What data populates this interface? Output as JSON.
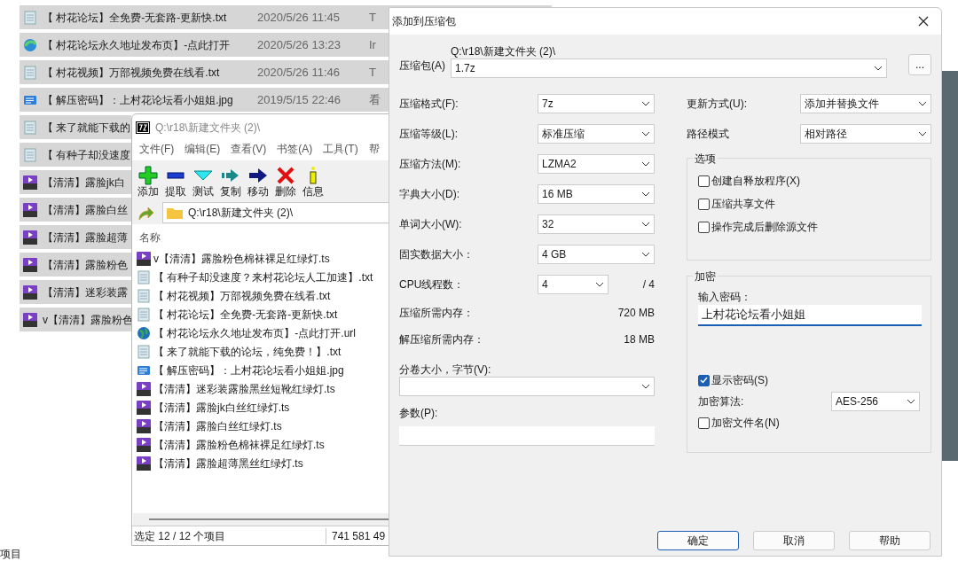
{
  "explorer": {
    "rows": [
      {
        "kind": "text",
        "name": "【 村花论坛】全免费-无套路-更新快.txt",
        "date": "2020/5/26 11:45",
        "column_3": "T",
        "selected": true
      },
      {
        "kind": "web",
        "name": "【 村花论坛永久地址发布页】-点此打开",
        "date": "2020/5/26 13:23",
        "column_3": "Ir",
        "selected": true
      },
      {
        "kind": "text",
        "name": "【 村花视频】万部视频免费在线看.txt",
        "date": "2020/5/26 11:46",
        "column_3": "T",
        "selected": true
      },
      {
        "kind": "image",
        "name": "【 解压密码】：上村花论坛看小姐姐.jpg",
        "date": "2019/5/15 22:46",
        "column_3": "看",
        "selected": true
      },
      {
        "kind": "text",
        "name": "【 来了就能下载的",
        "selected": true
      },
      {
        "kind": "text",
        "name": "【 有种子却没速度",
        "selected": true
      },
      {
        "kind": "video",
        "name": "【清清】露脸jk白",
        "selected": true
      },
      {
        "kind": "video",
        "name": "【清清】露脸白丝",
        "selected": true
      },
      {
        "kind": "video",
        "name": "【清清】露脸超薄",
        "selected": true
      },
      {
        "kind": "video",
        "name": "【清清】露脸粉色",
        "selected": true
      },
      {
        "kind": "video",
        "name": "【清清】迷彩装露",
        "selected": true
      },
      {
        "kind": "video",
        "name": "v【清清】露脸粉色",
        "selected": true
      }
    ],
    "status": "项目"
  },
  "archiver": {
    "title": "Q:\\r18\\新建文件夹 (2)\\",
    "menu": [
      "文件(F)",
      "编辑(E)",
      "查看(V)",
      "书签(A)",
      "工具(T)",
      "帮"
    ],
    "toolbar": [
      {
        "kind": "add",
        "label": "添加"
      },
      {
        "kind": "extract",
        "label": "提取"
      },
      {
        "kind": "test",
        "label": "测试"
      },
      {
        "kind": "copy",
        "label": "复制"
      },
      {
        "kind": "move",
        "label": "移动"
      },
      {
        "kind": "delete",
        "label": "删除"
      },
      {
        "kind": "info",
        "label": "信息"
      }
    ],
    "address": "Q:\\r18\\新建文件夹 (2)\\",
    "column": "名称",
    "files": [
      {
        "kind": "video",
        "name": "v【清清】露脸粉色棉袜裸足红绿灯.ts"
      },
      {
        "kind": "text",
        "name": "【 有种子却没速度？来村花论坛人工加速】.txt"
      },
      {
        "kind": "text",
        "name": "【 村花视频】万部视频免费在线看.txt"
      },
      {
        "kind": "text",
        "name": "【 村花论坛】全免费-无套路-更新快.txt"
      },
      {
        "kind": "link",
        "name": "【 村花论坛永久地址发布页】-点此打开.url"
      },
      {
        "kind": "text",
        "name": "【 来了就能下载的论坛，纯免费！】.txt"
      },
      {
        "kind": "image",
        "name": "【 解压密码】：上村花论坛看小姐姐.jpg"
      },
      {
        "kind": "video",
        "name": "【清清】迷彩装露脸黑丝短靴红绿灯.ts"
      },
      {
        "kind": "video",
        "name": "【清清】露脸jk白丝红绿灯.ts"
      },
      {
        "kind": "video",
        "name": "【清清】露脸白丝红绿灯.ts"
      },
      {
        "kind": "video",
        "name": "【清清】露脸粉色棉袜裸足红绿灯.ts"
      },
      {
        "kind": "video",
        "name": "【清清】露脸超薄黑丝红绿灯.ts"
      }
    ],
    "status_selection": "选定 12 / 12 个项目",
    "status_size": "741 581 49"
  },
  "dialog": {
    "title": "添加到压缩包",
    "archive_label": "压缩包(A)",
    "archive_folder": "Q:\\r18\\新建文件夹 (2)\\",
    "archive_name": "1.7z",
    "browse": "...",
    "settings": [
      {
        "label": "压缩格式(F):",
        "value": "7z"
      },
      {
        "label": "压缩等级(L):",
        "value": "标准压缩"
      },
      {
        "label": "压缩方法(M):",
        "value": "LZMA2"
      },
      {
        "label": "字典大小(D):",
        "value": "16 MB"
      },
      {
        "label": "单词大小(W):",
        "value": "32"
      },
      {
        "label": "固实数据大小：",
        "value": "4 GB"
      },
      {
        "label": "CPU线程数：",
        "value": "4",
        "suffix": "/ 4"
      }
    ],
    "memory": [
      {
        "label": "压缩所需内存：",
        "value": "720 MB"
      },
      {
        "label": "解压缩所需内存：",
        "value": "18 MB"
      }
    ],
    "volume_label": "分卷大小，字节(V):",
    "params_label": "参数(P):",
    "update": {
      "label": "更新方式(U):",
      "value": "添加并替换文件"
    },
    "path_mode": {
      "label": "路径模式",
      "value": "相对路径"
    },
    "options_title": "选项",
    "options": [
      {
        "label": "创建自释放程序(X)",
        "checked": false
      },
      {
        "label": "压缩共享文件",
        "checked": false
      },
      {
        "label": "操作完成后删除源文件",
        "checked": false
      }
    ],
    "encryption_title": "加密",
    "password_label": "输入密码：",
    "password": "上村花论坛看小姐姐",
    "password_focused": true,
    "show_password": {
      "label": "显示密码(S)",
      "checked": true
    },
    "method": {
      "label": "加密算法:",
      "value": "AES-256"
    },
    "encrypt_names": {
      "label": "加密文件名(N)",
      "checked": false
    },
    "buttons": [
      {
        "label": "确定",
        "default": true
      },
      {
        "label": "取消",
        "default": false
      },
      {
        "label": "帮助",
        "default": false
      }
    ]
  }
}
